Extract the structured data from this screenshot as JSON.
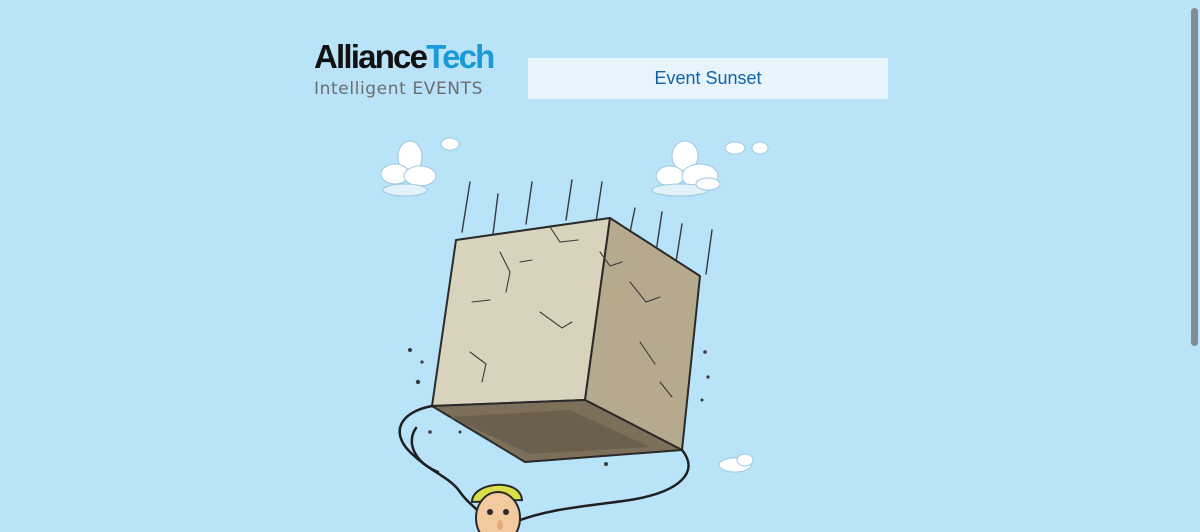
{
  "logo": {
    "brand_part1": "Alliance",
    "brand_part2": "Tech",
    "tagline": "Intelligent EVENTS"
  },
  "header": {
    "title": "Event Sunset"
  },
  "illustration": {
    "subject": "cartoon of a falling stone block above a worker in a hard hat"
  },
  "colors": {
    "background": "#b8e3f9",
    "title_box": "#e7f4fc",
    "title_text": "#1063a8",
    "logo_accent": "#1a9ad6"
  }
}
